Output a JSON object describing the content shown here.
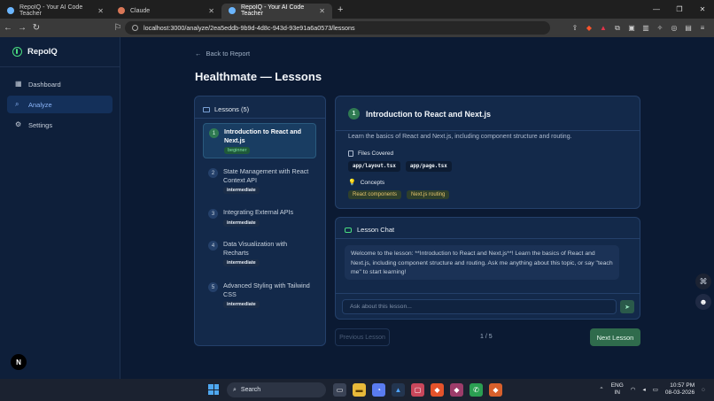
{
  "browser": {
    "tabs": [
      {
        "title": "RepoIQ - Your AI Code Teacher",
        "active": false,
        "favicon_color": "#6bb6ff"
      },
      {
        "title": "Claude",
        "active": false,
        "favicon_color": "#d97757"
      },
      {
        "title": "RepoIQ - Your AI Code Teacher",
        "active": true,
        "favicon_color": "#6bb6ff"
      }
    ],
    "url": "localhost:3000/analyze/2ea5eddb-9b9d-4d8c-943d-93e91a6a0573/lessons"
  },
  "sidebar": {
    "brand": "RepoIQ",
    "items": [
      {
        "label": "Dashboard",
        "icon": "grid-icon",
        "active": false
      },
      {
        "label": "Analyze",
        "icon": "search-icon",
        "active": true
      },
      {
        "label": "Settings",
        "icon": "gear-icon",
        "active": false
      }
    ],
    "badge": "N"
  },
  "main": {
    "back_label": "Back to Report",
    "title": "Healthmate — Lessons",
    "lessons_header": "Lessons (5)",
    "lessons": [
      {
        "num": "1",
        "title": "Introduction to React and Next.js",
        "level": "beginner",
        "active": true
      },
      {
        "num": "2",
        "title": "State Management with React Context API",
        "level": "intermediate",
        "active": false
      },
      {
        "num": "3",
        "title": "Integrating External APIs",
        "level": "intermediate",
        "active": false
      },
      {
        "num": "4",
        "title": "Data Visualization with Recharts",
        "level": "intermediate",
        "active": false
      },
      {
        "num": "5",
        "title": "Advanced Styling with Tailwind CSS",
        "level": "intermediate",
        "active": false
      }
    ],
    "current": {
      "num": "1",
      "title": "Introduction to React and Next.js",
      "description": "Learn the basics of React and Next.js, including component structure and routing.",
      "files_label": "Files Covered",
      "files": [
        "app/layout.tsx",
        "app/page.tsx"
      ],
      "concepts_label": "Concepts",
      "concepts": [
        "React components",
        "Next.js routing"
      ]
    },
    "chat": {
      "title": "Lesson Chat",
      "bot_message": "Welcome to the lesson: **Introduction to React and Next.js**! Learn the basics of React and Next.js, including component structure and routing. Ask me anything about this topic, or say \"teach me\" to start learning!",
      "input_placeholder": "Ask about this lesson..."
    },
    "pager": {
      "prev_label": "Previous Lesson",
      "status": "1 / 5",
      "next_label": "Next Lesson"
    }
  },
  "taskbar": {
    "search_label": "Search",
    "lang_line1": "ENG",
    "lang_line2": "IN",
    "time": "10:57 PM",
    "date": "08-03-2026"
  }
}
